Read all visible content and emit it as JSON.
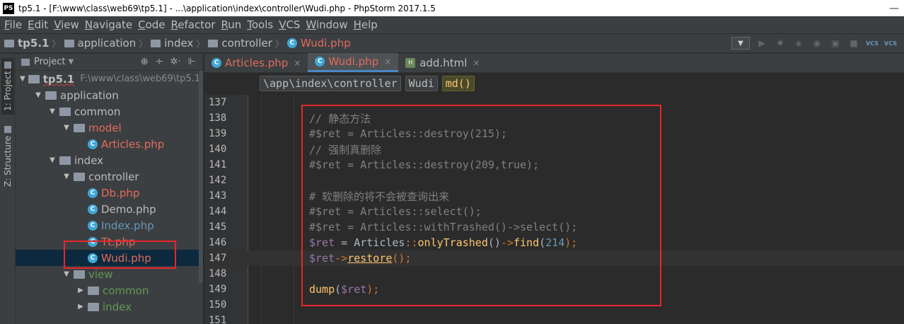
{
  "titlebar": {
    "app_icon": "PS",
    "title": "tp5.1 - [F:\\www\\class\\web69\\tp5.1] - ...\\application\\index\\controller\\Wudi.php - PhpStorm 2017.1.5",
    "minimize": "—"
  },
  "menu": [
    {
      "first": "F",
      "rest": "ile"
    },
    {
      "first": "E",
      "rest": "dit"
    },
    {
      "first": "V",
      "rest": "iew"
    },
    {
      "first": "N",
      "rest": "avigate"
    },
    {
      "first": "C",
      "rest": "ode"
    },
    {
      "first": "R",
      "rest": "efactor"
    },
    {
      "first": "R",
      "rest": "un"
    },
    {
      "first": "T",
      "rest": "ools"
    },
    {
      "first": "V",
      "rest": "CS"
    },
    {
      "first": "W",
      "rest": "indow"
    },
    {
      "first": "H",
      "rest": "elp"
    }
  ],
  "navbar": {
    "crumbs": [
      "tp5.1",
      "application",
      "index",
      "controller",
      "Wudi.php"
    ],
    "dropdown": "▼",
    "vcs1": "VCS",
    "vcs2": "VCS"
  },
  "toolstrip": {
    "project_tab": "1: Project",
    "structure_tab": "Z: Structure"
  },
  "project_panel": {
    "header": "Project",
    "caret": "▼",
    "tools": [
      "⊕",
      "÷",
      "✲·",
      "⊩"
    ],
    "tree": [
      {
        "label": "tp5.1",
        "note": "F:\\www\\class\\web69\\tp5.1",
        "arrow": "▼",
        "kind": "root"
      },
      {
        "label": "application",
        "arrow": "▼",
        "kind": "folder"
      },
      {
        "label": "common",
        "arrow": "▼",
        "kind": "folder"
      },
      {
        "label": "model",
        "arrow": "▼",
        "kind": "folder-red"
      },
      {
        "label": "Articles.php",
        "arrow": "",
        "kind": "file-red"
      },
      {
        "label": "index",
        "arrow": "▼",
        "kind": "folder"
      },
      {
        "label": "controller",
        "arrow": "▼",
        "kind": "folder"
      },
      {
        "label": "Db.php",
        "arrow": "",
        "kind": "file-red"
      },
      {
        "label": "Demo.php",
        "arrow": "",
        "kind": "file"
      },
      {
        "label": "Index.php",
        "arrow": "",
        "kind": "file-blue"
      },
      {
        "label": "Tt.php",
        "arrow": "",
        "kind": "file-red"
      },
      {
        "label": "Wudi.php",
        "arrow": "",
        "kind": "file-red"
      },
      {
        "label": "view",
        "arrow": "▼",
        "kind": "folder-green"
      },
      {
        "label": "common",
        "arrow": "▶",
        "kind": "folder-green"
      },
      {
        "label": "index",
        "arrow": "▶",
        "kind": "folder-green"
      }
    ]
  },
  "tabs": [
    {
      "label": "Articles.php",
      "icon": "C",
      "close": "×"
    },
    {
      "label": "Wudi.php",
      "icon": "C",
      "close": "×"
    },
    {
      "label": "add.html",
      "icon": "H",
      "close": "×"
    }
  ],
  "editor_breadcrumbs": [
    "\\app\\index\\controller",
    "Wudi",
    "md()"
  ],
  "code": {
    "lines": [
      {
        "num": "137",
        "text": ""
      },
      {
        "num": "138",
        "text": "// 静态方法"
      },
      {
        "num": "139",
        "text": "#$ret = Articles::destroy(215);"
      },
      {
        "num": "140",
        "text": "// 强制真删除"
      },
      {
        "num": "141",
        "text": "#$ret = Articles::destroy(209,true);"
      },
      {
        "num": "142",
        "text": ""
      },
      {
        "num": "143",
        "text": "# 软删除的将不会被查询出来"
      },
      {
        "num": "144",
        "text": "#$ret = Articles::select();"
      },
      {
        "num": "145",
        "text": "#$ret = Articles::withTrashed()->select();"
      },
      {
        "num": "146",
        "text": "$ret = Articles::onlyTrashed()->find(214);"
      },
      {
        "num": "147",
        "text": "$ret->restore();"
      },
      {
        "num": "148",
        "text": ""
      },
      {
        "num": "149",
        "text": "dump($ret);"
      },
      {
        "num": "150",
        "text": ""
      },
      {
        "num": "151",
        "text": ""
      }
    ],
    "tokens_146": {
      "var": "$ret",
      "eq": " = ",
      "cls": "Articles",
      "dc": "::",
      "m1": "onlyTrashed",
      "p1": "()",
      "arrow": "->",
      "m2": "find",
      "po": "(",
      "n": "214",
      "pc": ");"
    },
    "tokens_147": {
      "var": "$ret",
      "arrow": "->",
      "m": "restore",
      "p": "();"
    },
    "tokens_149": {
      "fn": "dump",
      "po": "(",
      "var": "$ret",
      "pc": ");"
    }
  },
  "colors": {
    "background": "#2b2b2b",
    "panel": "#3c3f41",
    "annotation": "#e8262a",
    "comment": "#808080",
    "variable": "#9876aa",
    "keyword": "#cc7832",
    "function": "#ffc66d",
    "number": "#6897bb"
  }
}
